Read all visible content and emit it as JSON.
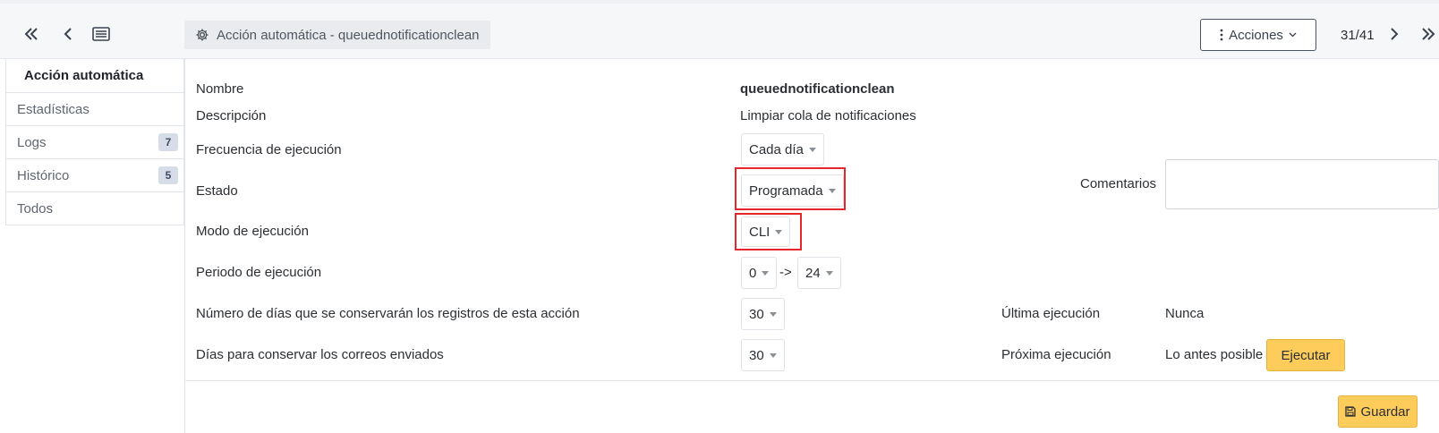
{
  "header": {
    "title": "Acción automática - queuednotificationclean",
    "actions_label": "Acciones",
    "pager": "31/41",
    "icons": {
      "first": "double-chevron-left-icon",
      "back": "chevron-left-icon",
      "list": "list-icon",
      "gear": "gear-icon",
      "kebab": "vertical-dots-icon",
      "next": "chevron-right-icon",
      "last": "double-chevron-right-icon"
    }
  },
  "sidebar": {
    "tabs": [
      {
        "label": "Acción automática",
        "badge": ""
      },
      {
        "label": "Estadísticas",
        "badge": ""
      },
      {
        "label": "Logs",
        "badge": "7"
      },
      {
        "label": "Histórico",
        "badge": "5"
      },
      {
        "label": "Todos",
        "badge": ""
      }
    ]
  },
  "form": {
    "nombre_label": "Nombre",
    "nombre_value": "queuednotificationclean",
    "descripcion_label": "Descripción",
    "descripcion_value": "Limpiar cola de notificaciones",
    "frecuencia_label": "Frecuencia de ejecución",
    "frecuencia_value": "Cada día",
    "estado_label": "Estado",
    "estado_value": "Programada",
    "comentarios_label": "Comentarios",
    "modo_label": "Modo de ejecución",
    "modo_value": "CLI",
    "periodo_label": "Periodo de ejecución",
    "periodo_from": "0",
    "periodo_arrow": "->",
    "periodo_to": "24",
    "dias_registros_label": "Número de días que se conservarán los registros de esta acción",
    "dias_registros_value": "30",
    "ultima_label": "Última ejecución",
    "ultima_value": "Nunca",
    "dias_correos_label": "Días para conservar los correos enviados",
    "dias_correos_value": "30",
    "proxima_label": "Próxima ejecución",
    "proxima_value": "Lo antes posible",
    "ejecutar_label": "Ejecutar",
    "guardar_label": "Guardar"
  },
  "colors": {
    "highlight": "#e5262a",
    "primary_button": "#fdcc5b"
  }
}
